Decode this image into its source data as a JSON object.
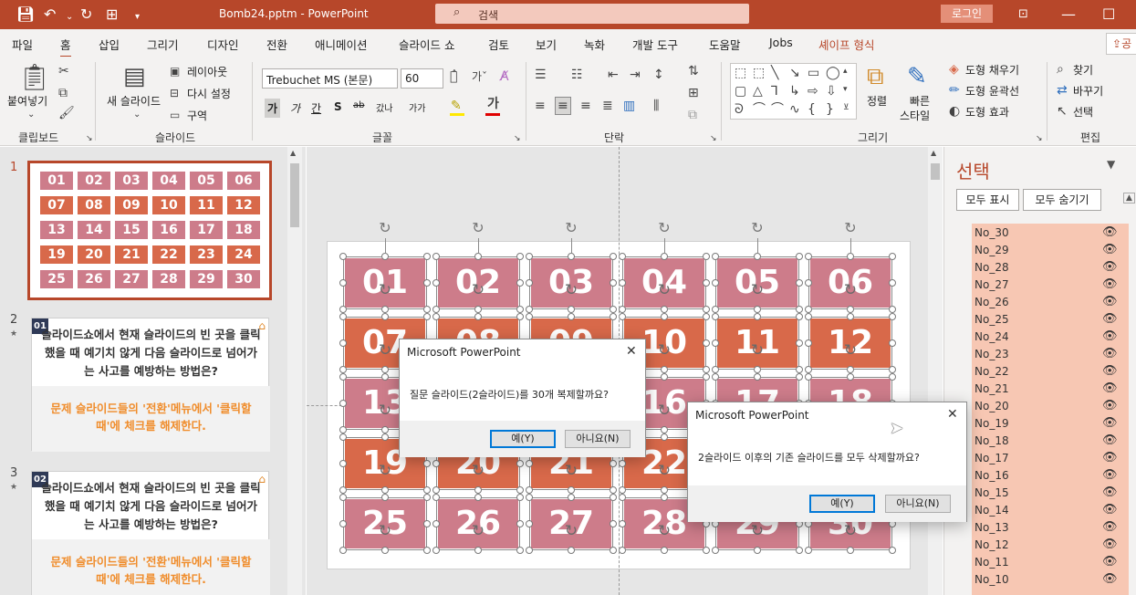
{
  "titlebar": {
    "filename": "Bomb24.pptm",
    "app": "PowerPoint",
    "title_text": "Bomb24.pptm  -  PowerPoint",
    "search_placeholder": "검색",
    "login_label": "로그인"
  },
  "menu": {
    "tabs": [
      "파일",
      "홈",
      "삽입",
      "그리기",
      "디자인",
      "전환",
      "애니메이션",
      "슬라이드 쇼",
      "검토",
      "보기",
      "녹화",
      "개발 도구",
      "도움말",
      "Jobs",
      "셰이프 형식"
    ],
    "active_tab": "홈",
    "share_label": "공"
  },
  "ribbon": {
    "clipboard": {
      "paste": "붙여넣기",
      "group": "클립보드"
    },
    "slides": {
      "new_slide_line1": "새 슬라이드",
      "layout": "레이아웃",
      "reset": "다시 설정",
      "section": "구역",
      "group": "슬라이드"
    },
    "font": {
      "font_name": "Trebuchet MS (본문)",
      "font_size": "60",
      "group": "글꼴",
      "bold": "가",
      "italic": "가",
      "underline": "간",
      "shadow": "S",
      "strike": "ab",
      "spacing": "갔나",
      "case": "가가"
    },
    "paragraph": {
      "group": "단락"
    },
    "drawing": {
      "arrange": "정렬",
      "quick_styles_1": "빠른",
      "quick_styles_2": "스타일",
      "fill": "도형 채우기",
      "outline": "도형 윤곽선",
      "effects": "도형 효과",
      "group": "그리기"
    },
    "editing": {
      "find": "찾기",
      "replace": "바꾸기",
      "select": "선택",
      "group": "편집"
    }
  },
  "thumbnails": {
    "slide1_number": "1",
    "slide1_cells": [
      "01",
      "02",
      "03",
      "04",
      "05",
      "06",
      "07",
      "08",
      "09",
      "10",
      "11",
      "12",
      "13",
      "14",
      "15",
      "16",
      "17",
      "18",
      "19",
      "20",
      "21",
      "22",
      "23",
      "24",
      "25",
      "26",
      "27",
      "28",
      "29",
      "30"
    ],
    "slides": [
      {
        "number": "2",
        "badge": "01",
        "question": "슬라이드쇼에서 현재 슬라이드의 빈 곳을 클릭했을 때 예기치 않게 다음 슬라이드로 넘어가는 사고를 예방하는 방법은?",
        "answer": "문제 슬라이드들의 '전환'메뉴에서 '클릭할 때'에 체크를 해제한다."
      },
      {
        "number": "3",
        "badge": "02",
        "question": "슬라이드쇼에서 현재 슬라이드의 빈 곳을 클릭했을 때 예기치 않게 다음 슬라이드로 넘어가는 사고를 예방하는 방법은?",
        "answer": "문제 슬라이드들의 '전환'메뉴에서 '클릭할 때'에 체크를 해제한다."
      }
    ]
  },
  "slide_tiles": [
    "01",
    "02",
    "03",
    "04",
    "05",
    "06",
    "07",
    "08",
    "09",
    "10",
    "11",
    "12",
    "13",
    "14",
    "15",
    "16",
    "17",
    "18",
    "19",
    "20",
    "21",
    "22",
    "23",
    "24",
    "25",
    "26",
    "27",
    "28",
    "29",
    "30"
  ],
  "colors": {
    "accent": "#b7472a",
    "tile_pink": "#cd7c8a",
    "tile_orange": "#d8694a",
    "selection_list": "#f7c7b3"
  },
  "selection_pane": {
    "title": "선택",
    "show_all": "모두 표시",
    "hide_all": "모두 숨기기",
    "items": [
      "No_30",
      "No_29",
      "No_28",
      "No_27",
      "No_26",
      "No_25",
      "No_24",
      "No_23",
      "No_22",
      "No_21",
      "No_20",
      "No_19",
      "No_18",
      "No_17",
      "No_16",
      "No_15",
      "No_14",
      "No_13",
      "No_12",
      "No_11",
      "No_10"
    ]
  },
  "dialog1": {
    "title": "Microsoft PowerPoint",
    "message": "질문 슬라이드(2슬라이드)를 30개 복제할까요?",
    "yes": "예(Y)",
    "no": "아니요(N)"
  },
  "dialog2": {
    "title": "Microsoft PowerPoint",
    "message": "2슬라이드 이후의 기존 슬라이드를 모두 삭제할까요?",
    "yes": "예(Y)",
    "no": "아니요(N)"
  }
}
